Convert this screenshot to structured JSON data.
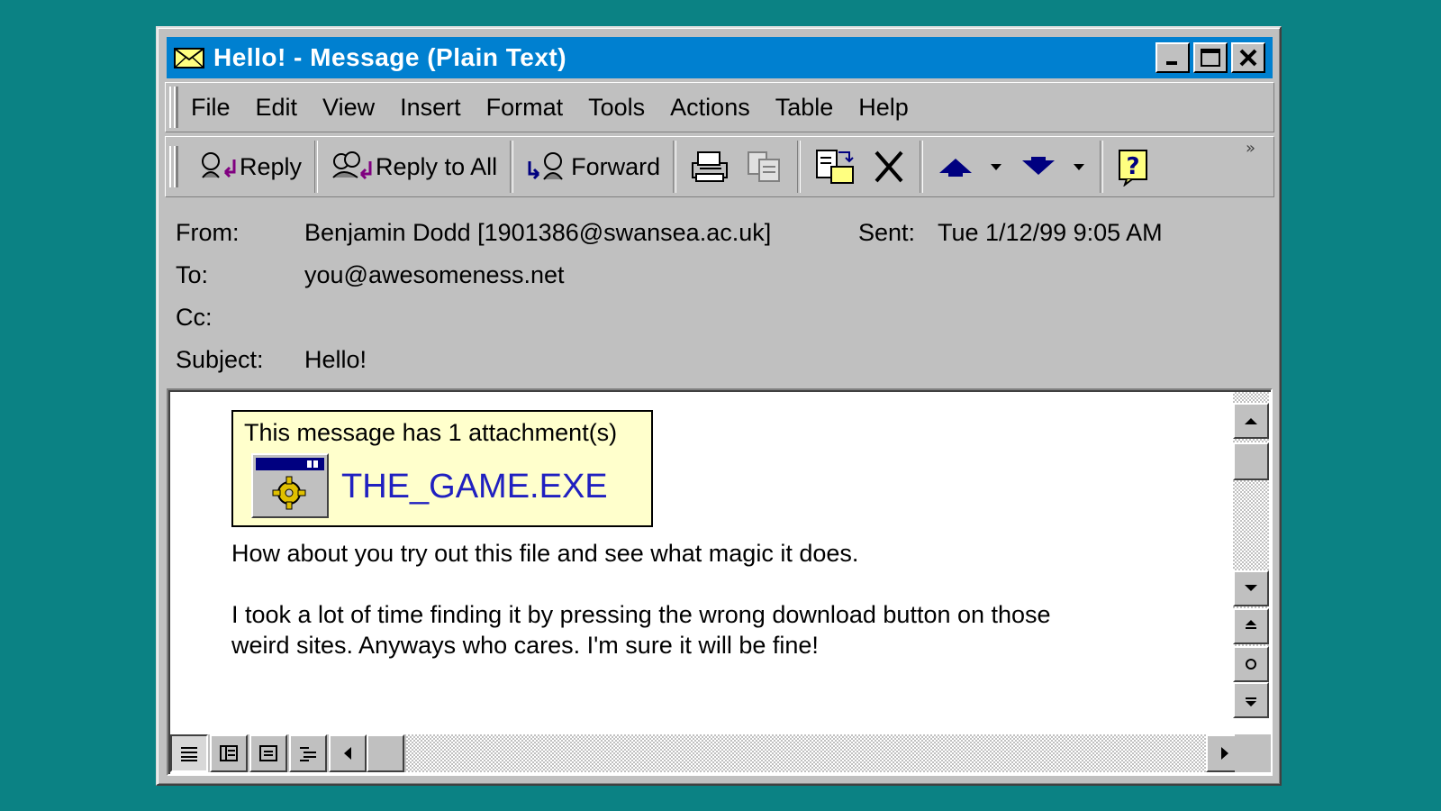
{
  "window": {
    "title": "Hello! - Message (Plain Text)",
    "controls": [
      "minimize",
      "maximize",
      "close"
    ]
  },
  "menubar": {
    "items": [
      {
        "label": "File"
      },
      {
        "label": "Edit"
      },
      {
        "label": "View"
      },
      {
        "label": "Insert"
      },
      {
        "label": "Format"
      },
      {
        "label": "Tools"
      },
      {
        "label": "Actions"
      },
      {
        "label": "Table"
      },
      {
        "label": "Help"
      }
    ]
  },
  "toolbar": {
    "reply_label": "Reply",
    "reply_all_label": "Reply to All",
    "forward_label": "Forward",
    "overflow": "»"
  },
  "header": {
    "from_label": "From:",
    "from_value": "Benjamin Dodd [1901386@swansea.ac.uk]",
    "sent_label": "Sent:",
    "sent_value": "Tue 1/12/99 9:05 AM",
    "to_label": "To:",
    "to_value": "you@awesomeness.net",
    "cc_label": "Cc:",
    "cc_value": "",
    "subject_label": "Subject:",
    "subject_value": "Hello!"
  },
  "message": {
    "attachment_notice": "This message has 1 attachment(s)",
    "attachment_name": "THE_GAME.EXE",
    "line1": "How about you try out this file and see what magic it does.",
    "line2": "I took a lot of time finding it by pressing the wrong download button on those",
    "line3": "weird sites. Anyways who cares. I'm sure it will  be fine!"
  },
  "colors": {
    "desktop": "#0b8284",
    "titlebar": "#0080d0",
    "window": "#c0c0c0",
    "attachment_bg": "#ffffcc",
    "attachment_link": "#2020c0"
  }
}
